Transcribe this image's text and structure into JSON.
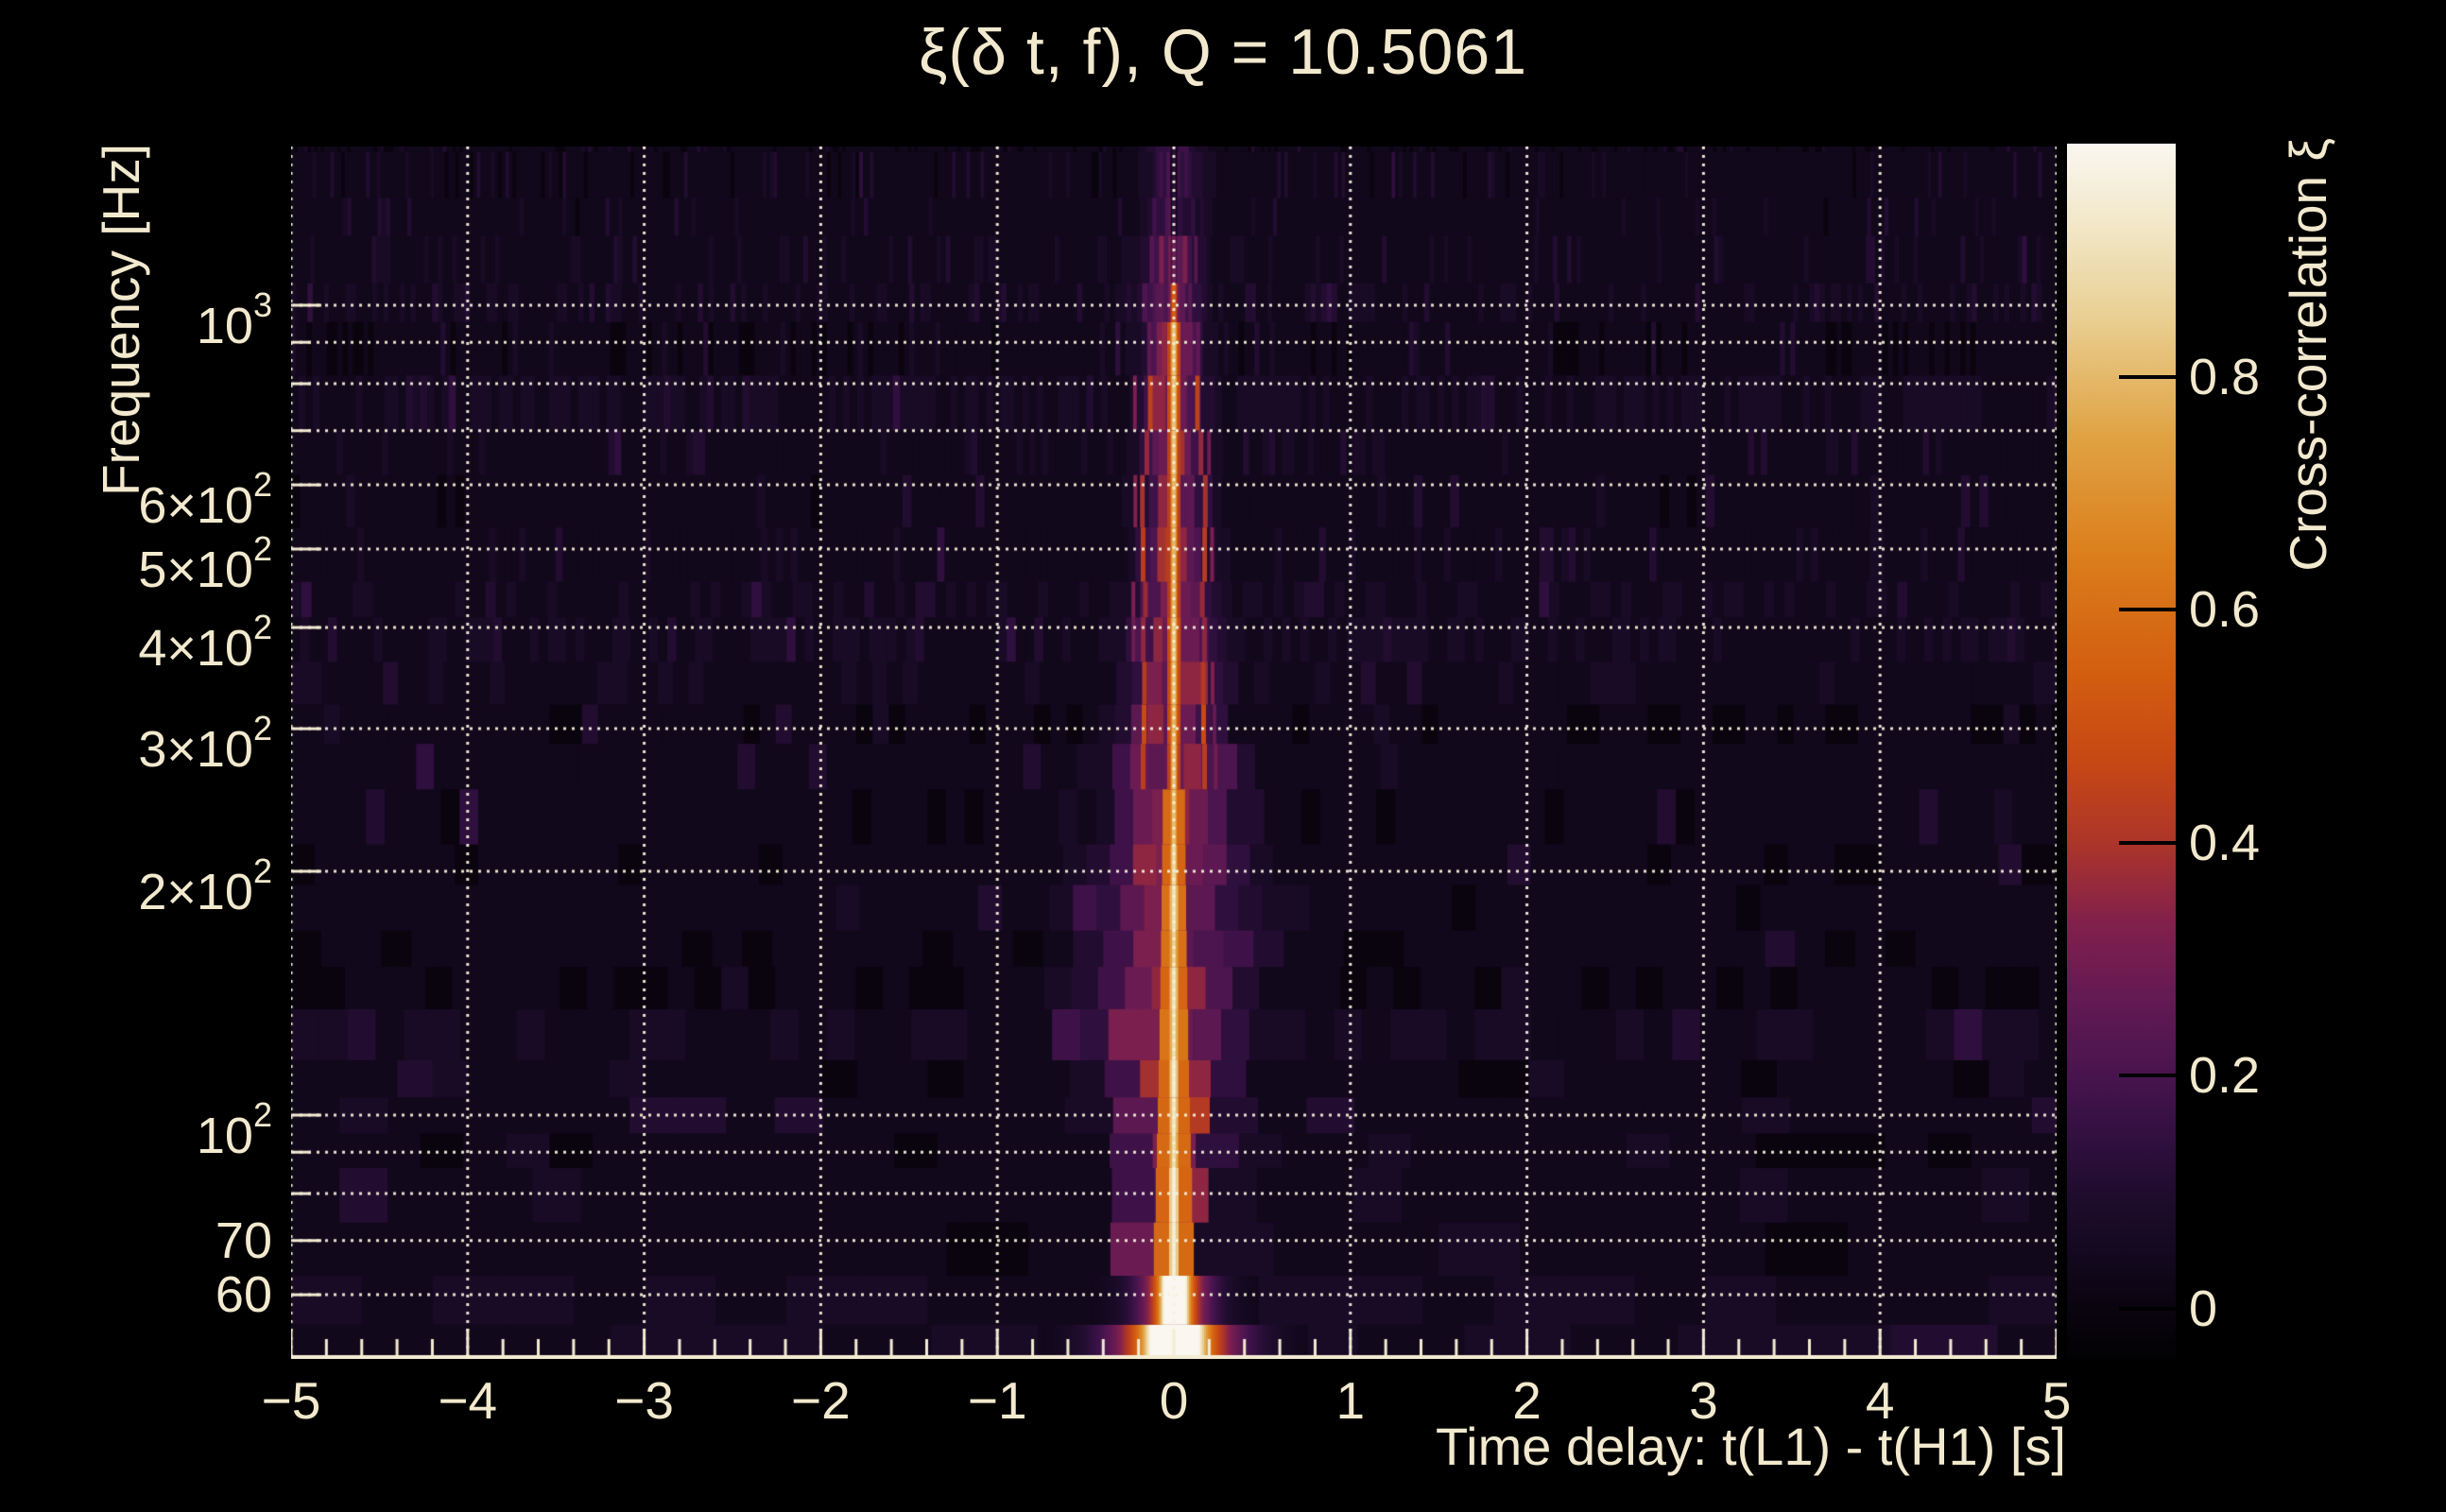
{
  "page": {
    "background": "#000000",
    "text_color": "#f2e9ce"
  },
  "chart_data": {
    "type": "heatmap",
    "title": "ξ(δ t, f), Q = 10.5061",
    "xlabel": "Time delay: t(L1) - t(H1) [s]",
    "ylabel": "Frequency [Hz]",
    "q_value": 10.5061,
    "legend_position": "right-colorbar",
    "grid": true,
    "x_axis": {
      "min": -5,
      "max": 5,
      "major_ticks": [
        -5,
        -4,
        -3,
        -2,
        -1,
        0,
        1,
        2,
        3,
        4,
        5
      ],
      "major_tick_labels": [
        "−5",
        "−4",
        "−3",
        "−2",
        "−1",
        "0",
        "1",
        "2",
        "3",
        "4",
        "5"
      ],
      "minor_tick_step": 0.2
    },
    "y_axis": {
      "scale": "log",
      "min_hz": 50,
      "max_hz": 1571,
      "tick_labels": [
        {
          "v": 1000,
          "mantissa": "10",
          "exp": "3"
        },
        {
          "v": 600,
          "mantissa": "6×10",
          "exp": "2"
        },
        {
          "v": 500,
          "mantissa": "5×10",
          "exp": "2"
        },
        {
          "v": 400,
          "mantissa": "4×10",
          "exp": "2"
        },
        {
          "v": 300,
          "mantissa": "3×10",
          "exp": "2"
        },
        {
          "v": 200,
          "mantissa": "2×10",
          "exp": "2"
        },
        {
          "v": 100,
          "mantissa": "10",
          "exp": "2"
        },
        {
          "v": 70,
          "mantissa": "70",
          "exp": ""
        },
        {
          "v": 60,
          "mantissa": "60",
          "exp": ""
        }
      ],
      "grid_lines_hz": [
        60,
        70,
        80,
        90,
        100,
        200,
        300,
        400,
        500,
        600,
        700,
        800,
        900,
        1000
      ],
      "major_tick_hz": [
        60,
        70,
        100,
        200,
        300,
        400,
        500,
        600,
        1000
      ],
      "minor_tick_hz": [
        80,
        90,
        700,
        800,
        900
      ]
    },
    "colorbar": {
      "label": "Cross-correlation ξ",
      "min": -0.045,
      "max": 1.0,
      "ticks": [
        {
          "v": 0.8,
          "label": "0.8"
        },
        {
          "v": 0.6,
          "label": "0.6"
        },
        {
          "v": 0.4,
          "label": "0.4"
        },
        {
          "v": 0.2,
          "label": "0.2"
        },
        {
          "v": 0.0,
          "label": "0"
        }
      ],
      "palette": [
        {
          "v": -0.045,
          "c": "#020102"
        },
        {
          "v": 0.0,
          "c": "#0a040f"
        },
        {
          "v": 0.05,
          "c": "#140920"
        },
        {
          "v": 0.1,
          "c": "#200c2e"
        },
        {
          "v": 0.15,
          "c": "#331041"
        },
        {
          "v": 0.2,
          "c": "#48144e"
        },
        {
          "v": 0.27,
          "c": "#651a53"
        },
        {
          "v": 0.33,
          "c": "#81204c"
        },
        {
          "v": 0.4,
          "c": "#ad3529"
        },
        {
          "v": 0.47,
          "c": "#c64814"
        },
        {
          "v": 0.55,
          "c": "#d35f10"
        },
        {
          "v": 0.65,
          "c": "#dc7f1d"
        },
        {
          "v": 0.75,
          "c": "#e0a344"
        },
        {
          "v": 0.85,
          "c": "#e9cf92"
        },
        {
          "v": 0.93,
          "c": "#f2e7c8"
        },
        {
          "v": 1.0,
          "c": "#faf7f0"
        }
      ]
    },
    "ridge": {
      "dt_s": 0.0,
      "peak_xi": 1.0,
      "peak_frequency_hz": 55,
      "bands": [
        {
          "f_hz": [
            50,
            56
          ],
          "core_xi": 1.0
        },
        {
          "f_hz": [
            56,
            63
          ],
          "core_xi": 1.0
        },
        {
          "f_hz": [
            63,
            90
          ],
          "core_xi": 0.97
        },
        {
          "f_hz": [
            90,
            160
          ],
          "core_xi": 0.95
        },
        {
          "f_hz": [
            160,
            230
          ],
          "core_xi": 0.9
        },
        {
          "f_hz": [
            230,
            900
          ],
          "core_xi": 0.82
        },
        {
          "f_hz": [
            900,
            1050
          ],
          "core_xi": 0.55
        },
        {
          "f_hz": [
            1050,
            1250
          ],
          "core_xi": 0.3
        },
        {
          "f_hz": [
            1250,
            1571
          ],
          "core_xi": 0.15
        }
      ]
    }
  },
  "colors": {
    "text": "#f2e9ce",
    "grid_dotted": "rgba(246,239,218,0.95)",
    "axis_tick": "#f3ebd2",
    "colorbar_tick": "#000000"
  }
}
